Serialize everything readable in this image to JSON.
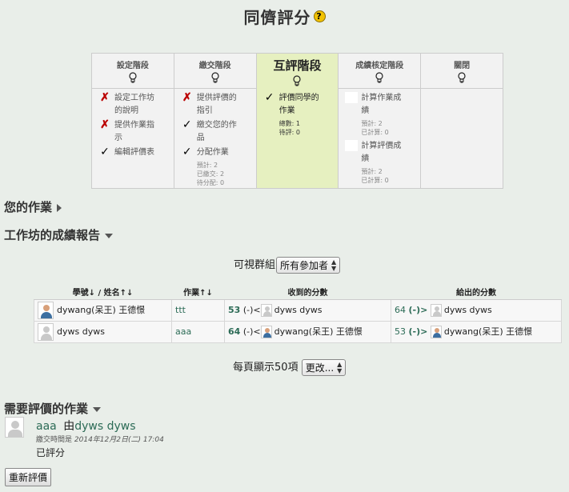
{
  "page": {
    "title": "同儕評分",
    "help": "?"
  },
  "phases": [
    {
      "title": "設定階段",
      "active": false,
      "tasks": [
        {
          "status": "fail",
          "label": "設定工作坊的說明"
        },
        {
          "status": "fail",
          "label": "提供作業指示"
        },
        {
          "status": "done",
          "label": "編輯評價表"
        }
      ]
    },
    {
      "title": "繳交階段",
      "active": false,
      "tasks": [
        {
          "status": "fail",
          "label": "提供評價的指引"
        },
        {
          "status": "done",
          "label": "繳交您的作品"
        },
        {
          "status": "done",
          "label": "分配作業",
          "stats": [
            "預計: 2",
            "已繳交: 2",
            "待分配: 0"
          ]
        }
      ]
    },
    {
      "title": "互評階段",
      "active": true,
      "tasks": [
        {
          "status": "done",
          "label": "評價同學的作業",
          "stats": [
            "總數: 1",
            "待評: 0"
          ]
        }
      ]
    },
    {
      "title": "成績核定階段",
      "active": false,
      "tasks": [
        {
          "status": "todo",
          "label": "計算作業成績",
          "stats": [
            "預計: 2",
            "已計算: 0"
          ]
        },
        {
          "status": "todo",
          "label": "計算評價成績",
          "stats": [
            "預計: 2",
            "已計算: 0"
          ]
        }
      ]
    },
    {
      "title": "關閉",
      "active": false,
      "tasks": []
    }
  ],
  "sections": {
    "your_work": "您的作業",
    "grades_report": "工作坊的成績報告",
    "to_assess": "需要評價的作業"
  },
  "group_filter": {
    "label": "可視群組",
    "value": "所有參加者"
  },
  "table": {
    "headers": {
      "name": "學號",
      "name2": "姓名",
      "submission": "作業",
      "received": "收到的分數",
      "given": "給出的分數"
    },
    "rows": [
      {
        "name": "dywang(呆王) 王德憬",
        "photo": true,
        "submission": "ttt",
        "received": {
          "grade": "53",
          "marker": "(-)<",
          "peer": "dyws dyws",
          "peer_photo": false
        },
        "given": {
          "grade": "64",
          "marker": "(-)>",
          "peer": "dyws dyws",
          "peer_photo": false
        }
      },
      {
        "name": "dyws dyws",
        "photo": false,
        "submission": "aaa",
        "received": {
          "grade": "64",
          "marker": "(-)<",
          "peer": "dywang(呆王) 王德憬",
          "peer_photo": true
        },
        "given": {
          "grade": "53",
          "marker": "(-)>",
          "peer": "dywang(呆王) 王德憬",
          "peer_photo": true
        }
      }
    ]
  },
  "per_page": {
    "label": "每頁顯示50項",
    "value": "更改..."
  },
  "assessment": {
    "title": "aaa",
    "by": "由",
    "author": "dyws dyws",
    "submitted_label": "繳交時間是",
    "submitted_date": "2014年12月2日(二) 17:04",
    "status": "已評分"
  },
  "reassess_button": "重新評價"
}
